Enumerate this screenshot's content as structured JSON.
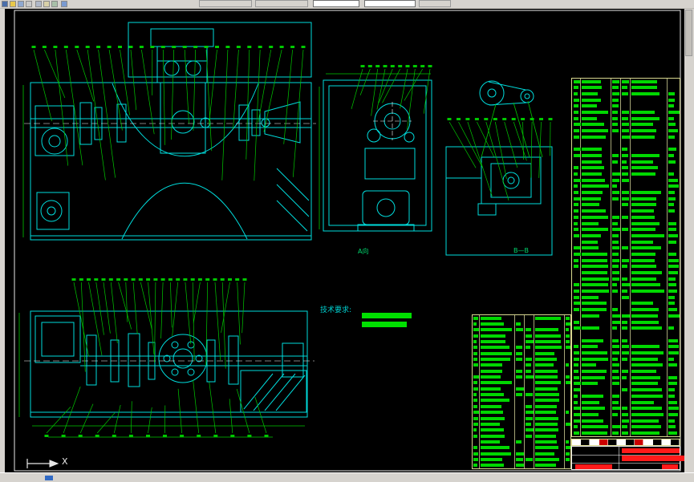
{
  "window_chrome": {
    "toolbar": {
      "icons": [
        "new-icon",
        "open-icon",
        "save-icon",
        "print-icon",
        "cut-icon",
        "copy-icon",
        "paste-icon",
        "undo-icon"
      ],
      "combo1_value": "",
      "combo2_value": ""
    },
    "statusbar_text": ""
  },
  "drawing": {
    "background_color": "#000000",
    "sheet_frame_color": "#e8e8e8",
    "line_color": "#00dcdc",
    "dimension_color": "#00c800",
    "table_text_color": "#00d800",
    "title_text_color": "#ff1a1a",
    "tech_req_label": "技术要求:",
    "view_label_a": "A向",
    "view_label_b": "B—B",
    "axis_x_label": "X"
  },
  "tables": {
    "parts_list_right": {
      "rows": 58
    },
    "parts_list_middle": {
      "rows": 26
    }
  }
}
